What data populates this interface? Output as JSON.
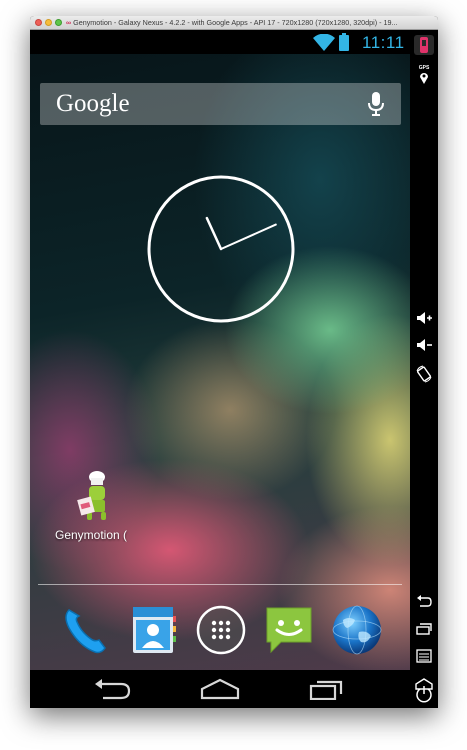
{
  "window": {
    "title": "Genymotion - Galaxy Nexus - 4.2.2 - with Google Apps - API 17 - 720x1280 (720x1280, 320dpi) - 19..."
  },
  "statusbar": {
    "time": "11:11",
    "wifi_icon": "wifi-icon",
    "battery_icon": "battery-icon",
    "accent_color": "#33b5e5"
  },
  "search": {
    "logo_text": "Google",
    "mic_icon": "microphone-icon"
  },
  "clock": {
    "hour": 11,
    "minute": 11,
    "style": "analog"
  },
  "home": {
    "apps": [
      {
        "label": "Genymotion (",
        "icon": "genymotion-app-icon"
      }
    ]
  },
  "dock": {
    "items": [
      {
        "name": "phone",
        "icon": "phone-icon"
      },
      {
        "name": "contacts",
        "icon": "contacts-icon"
      },
      {
        "name": "all-apps",
        "icon": "app-drawer-icon"
      },
      {
        "name": "messaging",
        "icon": "messaging-icon"
      },
      {
        "name": "browser",
        "icon": "browser-globe-icon"
      }
    ]
  },
  "navbar": {
    "buttons": [
      {
        "name": "back",
        "icon": "back-icon"
      },
      {
        "name": "home",
        "icon": "home-icon"
      },
      {
        "name": "recents",
        "icon": "recent-apps-icon"
      }
    ]
  },
  "sidebar": {
    "gps_label": "GPS",
    "buttons": [
      {
        "name": "gps",
        "icon": "location-pin-icon"
      },
      {
        "name": "volume-up",
        "icon": "volume-up-icon"
      },
      {
        "name": "volume-down",
        "icon": "volume-down-icon"
      },
      {
        "name": "rotate",
        "icon": "rotate-icon"
      },
      {
        "name": "back",
        "icon": "back-icon"
      },
      {
        "name": "recent-apps",
        "icon": "recent-apps-icon"
      },
      {
        "name": "menu",
        "icon": "menu-icon"
      },
      {
        "name": "home",
        "icon": "home-icon"
      },
      {
        "name": "power",
        "icon": "power-icon"
      }
    ]
  }
}
